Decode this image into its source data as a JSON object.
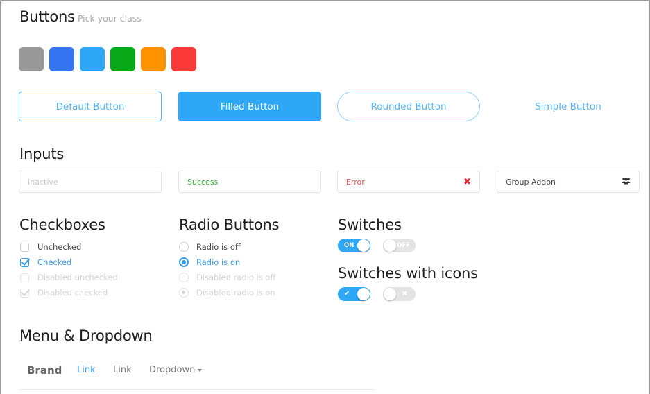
{
  "buttons_section": {
    "title": "Buttons",
    "subtitle": "Pick your class",
    "swatches": [
      {
        "name": "gray",
        "color": "#999999"
      },
      {
        "name": "blue",
        "color": "#3575f3"
      },
      {
        "name": "light-blue",
        "color": "#2ea8f6"
      },
      {
        "name": "green",
        "color": "#08a818"
      },
      {
        "name": "orange",
        "color": "#ff9200"
      },
      {
        "name": "red",
        "color": "#fa3838"
      }
    ],
    "default_label": "Default Button",
    "filled_label": "Filled Button",
    "rounded_label": "Rounded Button",
    "simple_label": "Simple Button"
  },
  "inputs_section": {
    "title": "Inputs",
    "inactive_placeholder": "Inactive",
    "success_value": "Success",
    "error_value": "Error",
    "error_icon": "✖",
    "group_value": "Group Addon",
    "group_icon": "users-icon"
  },
  "checkboxes_section": {
    "title": "Checkboxes",
    "items": [
      {
        "label": "Unchecked",
        "checked": false,
        "disabled": false
      },
      {
        "label": "Checked",
        "checked": true,
        "disabled": false
      },
      {
        "label": "Disabled unchecked",
        "checked": false,
        "disabled": true
      },
      {
        "label": "Disabled checked",
        "checked": true,
        "disabled": true
      }
    ]
  },
  "radio_section": {
    "title": "Radio Buttons",
    "items": [
      {
        "label": "Radio is off",
        "on": false,
        "disabled": false
      },
      {
        "label": "Radio is on",
        "on": true,
        "disabled": false
      },
      {
        "label": "Disabled radio is off",
        "on": false,
        "disabled": true
      },
      {
        "label": "Disabled radio is on",
        "on": true,
        "disabled": true
      }
    ]
  },
  "switches_section": {
    "title": "Switches",
    "on_label": "ON",
    "off_label": "OFF"
  },
  "icon_switches_section": {
    "title": "Switches with icons",
    "on_icon": "✔",
    "off_icon": "✖"
  },
  "menu_section": {
    "title": "Menu & Dropdown",
    "brand": "Brand",
    "links": [
      "Link",
      "Link"
    ],
    "dropdown": "Dropdown"
  }
}
